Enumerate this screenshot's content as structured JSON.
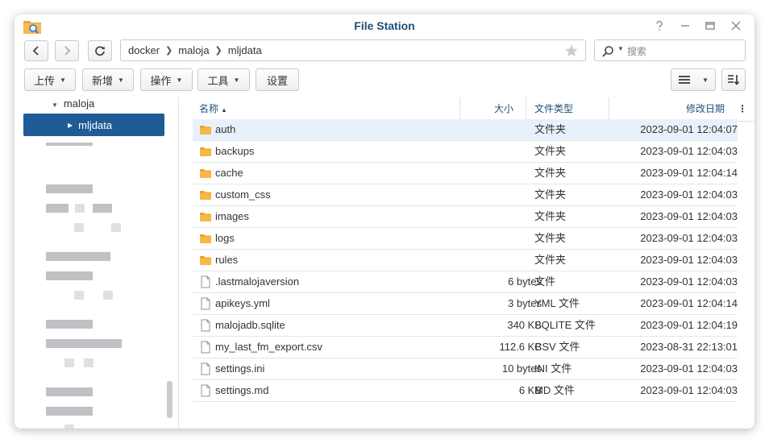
{
  "window": {
    "title": "File Station"
  },
  "path": {
    "crumbs": [
      "docker",
      "maloja",
      "mljdata"
    ]
  },
  "search": {
    "placeholder": "搜索"
  },
  "toolbar": {
    "upload": "上传",
    "new": "新增",
    "action": "操作",
    "tools": "工具",
    "settings": "设置"
  },
  "sidebar": {
    "parent": "maloja",
    "selected": "mljdata"
  },
  "columns": {
    "name": "名称",
    "sort_indicator": "▲",
    "size": "大小",
    "type": "文件类型",
    "modified": "修改日期"
  },
  "files": [
    {
      "name": "auth",
      "size": "",
      "type": "文件夹",
      "modified": "2023-09-01 12:04:07",
      "icon": "folder-icon"
    },
    {
      "name": "backups",
      "size": "",
      "type": "文件夹",
      "modified": "2023-09-01 12:04:03",
      "icon": "folder-icon"
    },
    {
      "name": "cache",
      "size": "",
      "type": "文件夹",
      "modified": "2023-09-01 12:04:14",
      "icon": "folder-icon"
    },
    {
      "name": "custom_css",
      "size": "",
      "type": "文件夹",
      "modified": "2023-09-01 12:04:03",
      "icon": "folder-icon"
    },
    {
      "name": "images",
      "size": "",
      "type": "文件夹",
      "modified": "2023-09-01 12:04:03",
      "icon": "folder-icon"
    },
    {
      "name": "logs",
      "size": "",
      "type": "文件夹",
      "modified": "2023-09-01 12:04:03",
      "icon": "folder-icon"
    },
    {
      "name": "rules",
      "size": "",
      "type": "文件夹",
      "modified": "2023-09-01 12:04:03",
      "icon": "folder-icon"
    },
    {
      "name": ".lastmalojaversion",
      "size": "6 bytes",
      "type": "文件",
      "modified": "2023-09-01 12:04:03",
      "icon": "file-icon"
    },
    {
      "name": "apikeys.yml",
      "size": "3 bytes",
      "type": "YML 文件",
      "modified": "2023-09-01 12:04:14",
      "icon": "file-icon"
    },
    {
      "name": "malojadb.sqlite",
      "size": "340 KB",
      "type": "SQLITE 文件",
      "modified": "2023-09-01 12:04:19",
      "icon": "file-icon"
    },
    {
      "name": "my_last_fm_export.csv",
      "size": "112.6 KB",
      "type": "CSV 文件",
      "modified": "2023-08-31 22:13:01",
      "icon": "file-icon"
    },
    {
      "name": "settings.ini",
      "size": "10 bytes",
      "type": "INI 文件",
      "modified": "2023-09-01 12:04:03",
      "icon": "file-icon"
    },
    {
      "name": "settings.md",
      "size": "6 KB",
      "type": "MD 文件",
      "modified": "2023-09-01 12:04:03",
      "icon": "file-icon"
    }
  ],
  "colors": {
    "accent": "#1f5b94",
    "title": "#1e4f7a",
    "folder": "#f5a623",
    "selected_row": "#e8f1fb"
  }
}
